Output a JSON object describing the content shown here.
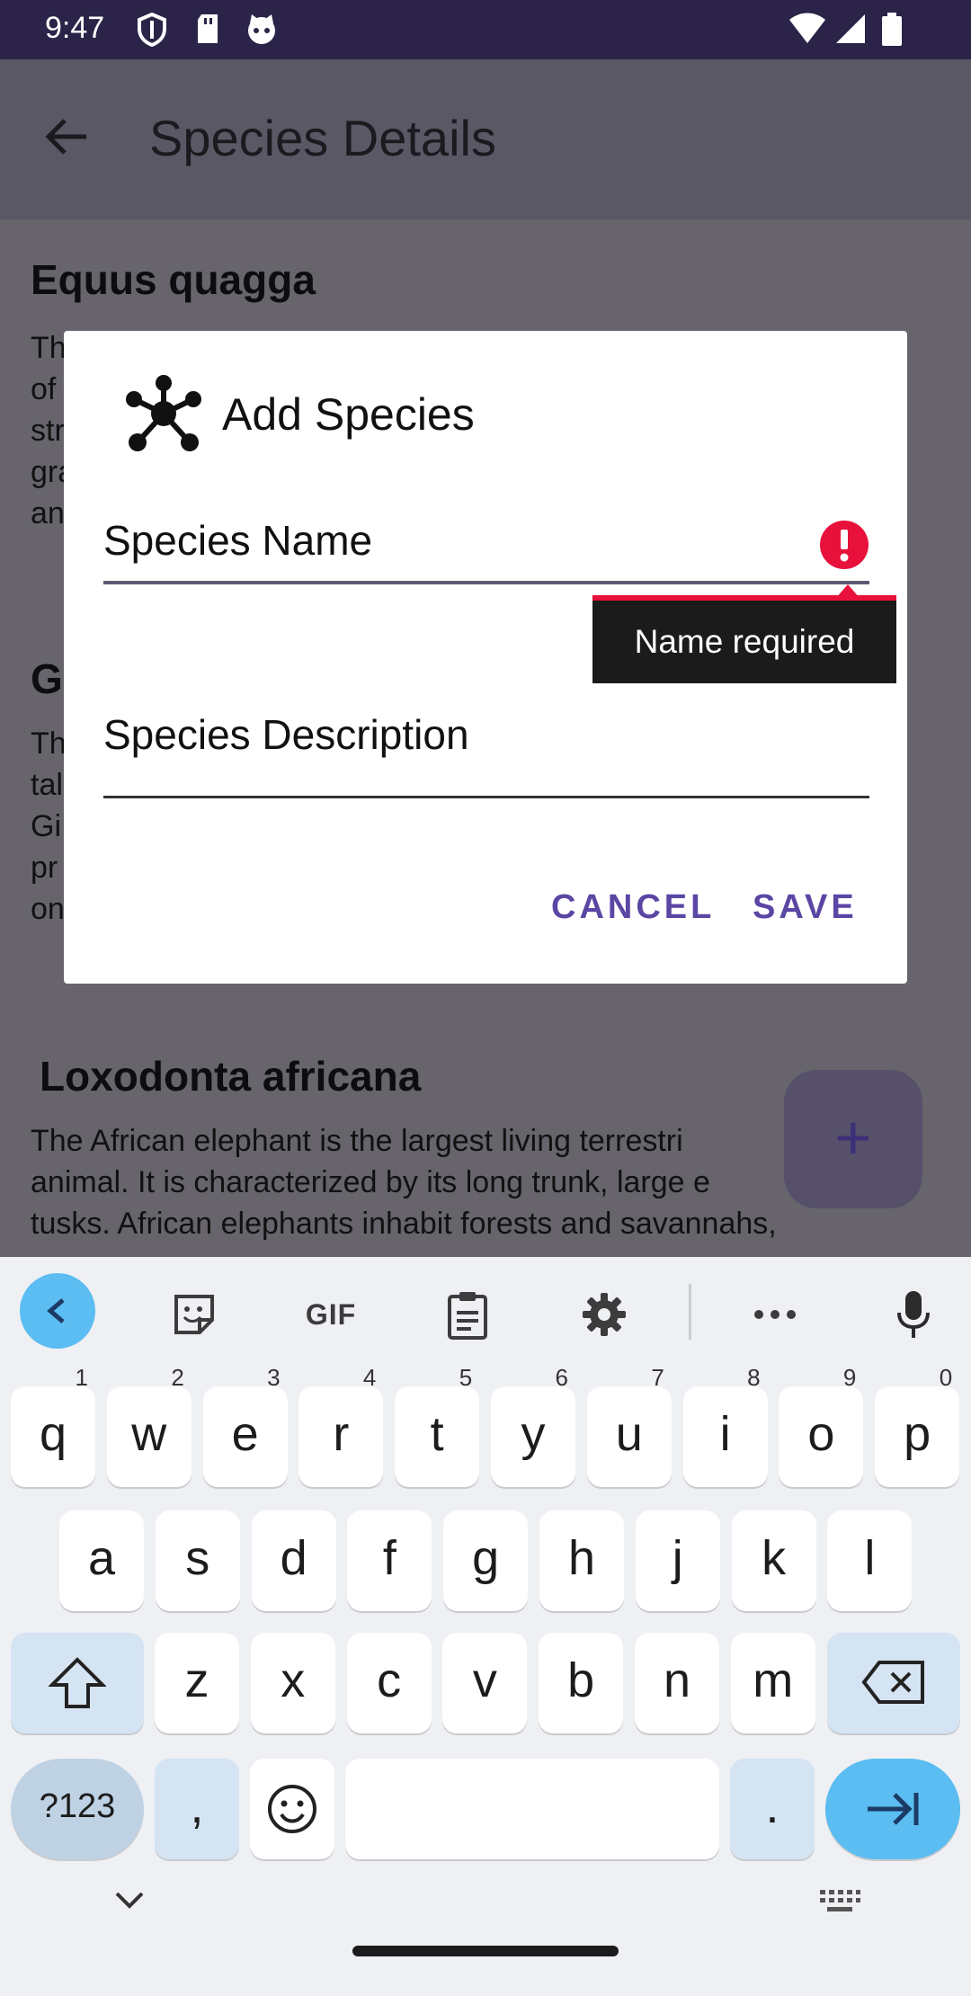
{
  "status_bar": {
    "time": "9:47"
  },
  "app_bar": {
    "title": "Species Details"
  },
  "background": {
    "species": [
      {
        "name": "Equus quagga",
        "desc_lines": [
          " Th",
          "of",
          "str",
          "gra",
          "an"
        ]
      },
      {
        "name": "Gi",
        "desc_lines": [
          " Th",
          "tal",
          "Gi",
          "pr",
          "on"
        ]
      },
      {
        "name": "Loxodonta africana",
        "desc_lines": [
          "The African elephant is the largest living terrestri",
          "animal. It is characterized by its long trunk, large e",
          "tusks. African elephants inhabit forests and savannahs,"
        ]
      }
    ],
    "fab_label": "+"
  },
  "dialog": {
    "title": "Add Species",
    "name_field": {
      "value": "Species Name",
      "error": "Name required"
    },
    "desc_field": {
      "placeholder": "Species Description"
    },
    "cancel_label": "CANCEL",
    "save_label": "SAVE"
  },
  "keyboard": {
    "toolbar": {
      "gif_label": "GIF"
    },
    "row1": [
      {
        "k": "q",
        "n": "1"
      },
      {
        "k": "w",
        "n": "2"
      },
      {
        "k": "e",
        "n": "3"
      },
      {
        "k": "r",
        "n": "4"
      },
      {
        "k": "t",
        "n": "5"
      },
      {
        "k": "y",
        "n": "6"
      },
      {
        "k": "u",
        "n": "7"
      },
      {
        "k": "i",
        "n": "8"
      },
      {
        "k": "o",
        "n": "9"
      },
      {
        "k": "p",
        "n": "0"
      }
    ],
    "row2": [
      "a",
      "s",
      "d",
      "f",
      "g",
      "h",
      "j",
      "k",
      "l"
    ],
    "row3": [
      "z",
      "x",
      "c",
      "v",
      "b",
      "n",
      "m"
    ],
    "symbols_label": "?123",
    "comma_label": ",",
    "period_label": "."
  },
  "colors": {
    "accent": "#5b46a4",
    "error": "#e8113b",
    "statusbar": "#2b2448",
    "enter_key": "#5bbdf2"
  }
}
